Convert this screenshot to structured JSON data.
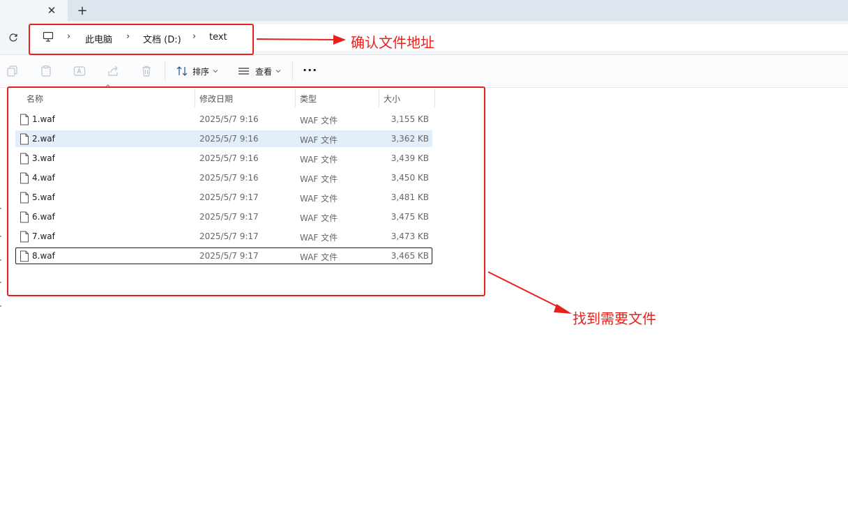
{
  "tab": {
    "close_glyph": "✕",
    "new_tab_glyph": "+"
  },
  "address": {
    "refresh_icon": "refresh-icon",
    "root_icon": "computer-icon",
    "crumbs": [
      "此电脑",
      "文档 (D:)",
      "text"
    ],
    "separator": "›"
  },
  "toolbar": {
    "icons": [
      "copy-icon",
      "paste-icon",
      "rename-icon",
      "share-icon",
      "delete-icon"
    ],
    "sort_label": "排序",
    "view_label": "查看",
    "more_label": "···"
  },
  "columns": {
    "name": "名称",
    "date": "修改日期",
    "type": "类型",
    "size": "大小"
  },
  "files": [
    {
      "name": "1.waf",
      "date": "2025/5/7 9:16",
      "type": "WAF 文件",
      "size": "3,155 KB"
    },
    {
      "name": "2.waf",
      "date": "2025/5/7 9:16",
      "type": "WAF 文件",
      "size": "3,362 KB"
    },
    {
      "name": "3.waf",
      "date": "2025/5/7 9:16",
      "type": "WAF 文件",
      "size": "3,439 KB"
    },
    {
      "name": "4.waf",
      "date": "2025/5/7 9:16",
      "type": "WAF 文件",
      "size": "3,450 KB"
    },
    {
      "name": "5.waf",
      "date": "2025/5/7 9:17",
      "type": "WAF 文件",
      "size": "3,481 KB"
    },
    {
      "name": "6.waf",
      "date": "2025/5/7 9:17",
      "type": "WAF 文件",
      "size": "3,475 KB"
    },
    {
      "name": "7.waf",
      "date": "2025/5/7 9:17",
      "type": "WAF 文件",
      "size": "3,473 KB"
    },
    {
      "name": "8.waf",
      "date": "2025/5/7 9:17",
      "type": "WAF 文件",
      "size": "3,465 KB"
    }
  ],
  "annotations": {
    "confirm_address": "确认文件地址",
    "find_file": "找到需要文件",
    "color": "#e8201c"
  },
  "selection": {
    "hover_row": "2.waf",
    "focused_row": "8.waf"
  }
}
